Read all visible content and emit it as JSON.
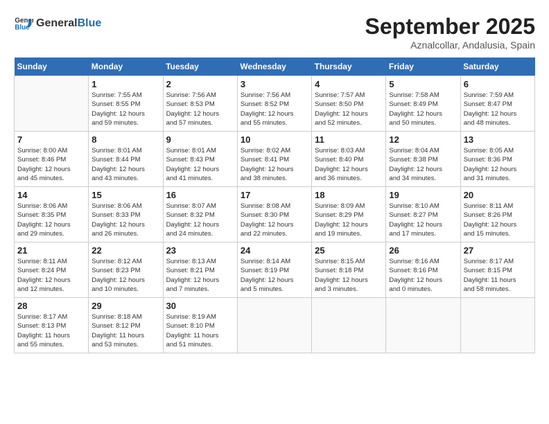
{
  "header": {
    "logo_general": "General",
    "logo_blue": "Blue",
    "month": "September 2025",
    "location": "Aznalcollar, Andalusia, Spain"
  },
  "days_of_week": [
    "Sunday",
    "Monday",
    "Tuesday",
    "Wednesday",
    "Thursday",
    "Friday",
    "Saturday"
  ],
  "weeks": [
    [
      {
        "day": "",
        "info": ""
      },
      {
        "day": "1",
        "info": "Sunrise: 7:55 AM\nSunset: 8:55 PM\nDaylight: 12 hours\nand 59 minutes."
      },
      {
        "day": "2",
        "info": "Sunrise: 7:56 AM\nSunset: 8:53 PM\nDaylight: 12 hours\nand 57 minutes."
      },
      {
        "day": "3",
        "info": "Sunrise: 7:56 AM\nSunset: 8:52 PM\nDaylight: 12 hours\nand 55 minutes."
      },
      {
        "day": "4",
        "info": "Sunrise: 7:57 AM\nSunset: 8:50 PM\nDaylight: 12 hours\nand 52 minutes."
      },
      {
        "day": "5",
        "info": "Sunrise: 7:58 AM\nSunset: 8:49 PM\nDaylight: 12 hours\nand 50 minutes."
      },
      {
        "day": "6",
        "info": "Sunrise: 7:59 AM\nSunset: 8:47 PM\nDaylight: 12 hours\nand 48 minutes."
      }
    ],
    [
      {
        "day": "7",
        "info": "Sunrise: 8:00 AM\nSunset: 8:46 PM\nDaylight: 12 hours\nand 45 minutes."
      },
      {
        "day": "8",
        "info": "Sunrise: 8:01 AM\nSunset: 8:44 PM\nDaylight: 12 hours\nand 43 minutes."
      },
      {
        "day": "9",
        "info": "Sunrise: 8:01 AM\nSunset: 8:43 PM\nDaylight: 12 hours\nand 41 minutes."
      },
      {
        "day": "10",
        "info": "Sunrise: 8:02 AM\nSunset: 8:41 PM\nDaylight: 12 hours\nand 38 minutes."
      },
      {
        "day": "11",
        "info": "Sunrise: 8:03 AM\nSunset: 8:40 PM\nDaylight: 12 hours\nand 36 minutes."
      },
      {
        "day": "12",
        "info": "Sunrise: 8:04 AM\nSunset: 8:38 PM\nDaylight: 12 hours\nand 34 minutes."
      },
      {
        "day": "13",
        "info": "Sunrise: 8:05 AM\nSunset: 8:36 PM\nDaylight: 12 hours\nand 31 minutes."
      }
    ],
    [
      {
        "day": "14",
        "info": "Sunrise: 8:06 AM\nSunset: 8:35 PM\nDaylight: 12 hours\nand 29 minutes."
      },
      {
        "day": "15",
        "info": "Sunrise: 8:06 AM\nSunset: 8:33 PM\nDaylight: 12 hours\nand 26 minutes."
      },
      {
        "day": "16",
        "info": "Sunrise: 8:07 AM\nSunset: 8:32 PM\nDaylight: 12 hours\nand 24 minutes."
      },
      {
        "day": "17",
        "info": "Sunrise: 8:08 AM\nSunset: 8:30 PM\nDaylight: 12 hours\nand 22 minutes."
      },
      {
        "day": "18",
        "info": "Sunrise: 8:09 AM\nSunset: 8:29 PM\nDaylight: 12 hours\nand 19 minutes."
      },
      {
        "day": "19",
        "info": "Sunrise: 8:10 AM\nSunset: 8:27 PM\nDaylight: 12 hours\nand 17 minutes."
      },
      {
        "day": "20",
        "info": "Sunrise: 8:11 AM\nSunset: 8:26 PM\nDaylight: 12 hours\nand 15 minutes."
      }
    ],
    [
      {
        "day": "21",
        "info": "Sunrise: 8:11 AM\nSunset: 8:24 PM\nDaylight: 12 hours\nand 12 minutes."
      },
      {
        "day": "22",
        "info": "Sunrise: 8:12 AM\nSunset: 8:23 PM\nDaylight: 12 hours\nand 10 minutes."
      },
      {
        "day": "23",
        "info": "Sunrise: 8:13 AM\nSunset: 8:21 PM\nDaylight: 12 hours\nand 7 minutes."
      },
      {
        "day": "24",
        "info": "Sunrise: 8:14 AM\nSunset: 8:19 PM\nDaylight: 12 hours\nand 5 minutes."
      },
      {
        "day": "25",
        "info": "Sunrise: 8:15 AM\nSunset: 8:18 PM\nDaylight: 12 hours\nand 3 minutes."
      },
      {
        "day": "26",
        "info": "Sunrise: 8:16 AM\nSunset: 8:16 PM\nDaylight: 12 hours\nand 0 minutes."
      },
      {
        "day": "27",
        "info": "Sunrise: 8:17 AM\nSunset: 8:15 PM\nDaylight: 11 hours\nand 58 minutes."
      }
    ],
    [
      {
        "day": "28",
        "info": "Sunrise: 8:17 AM\nSunset: 8:13 PM\nDaylight: 11 hours\nand 55 minutes."
      },
      {
        "day": "29",
        "info": "Sunrise: 8:18 AM\nSunset: 8:12 PM\nDaylight: 11 hours\nand 53 minutes."
      },
      {
        "day": "30",
        "info": "Sunrise: 8:19 AM\nSunset: 8:10 PM\nDaylight: 11 hours\nand 51 minutes."
      },
      {
        "day": "",
        "info": ""
      },
      {
        "day": "",
        "info": ""
      },
      {
        "day": "",
        "info": ""
      },
      {
        "day": "",
        "info": ""
      }
    ]
  ]
}
